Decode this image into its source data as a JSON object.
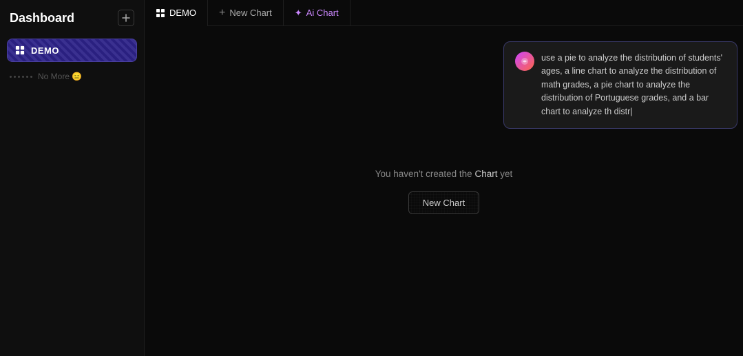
{
  "sidebar": {
    "title": "Dashboard",
    "add_button_label": "+",
    "items": [
      {
        "id": "demo",
        "label": "DEMO",
        "active": true
      }
    ],
    "no_more_label": "No More 😑"
  },
  "nav": {
    "tabs": [
      {
        "id": "demo",
        "label": "DEMO",
        "icon": "grid",
        "active": true
      },
      {
        "id": "new-chart",
        "label": "New Chart",
        "icon": "plus",
        "active": false
      },
      {
        "id": "ai-chart",
        "label": "Ai Chart",
        "icon": "sparkle",
        "active": false
      }
    ]
  },
  "content": {
    "empty_text": "You haven't created the Chart yet",
    "empty_text_bold": "Chart",
    "new_chart_button": "New Chart"
  },
  "ai_tooltip": {
    "text": "use a pie to analyze the distribution of students' ages, a line chart to analyze the distribution of math grades, a pie chart to analyze the distribution of Portuguese grades, and a bar chart to analyze th distr|"
  }
}
